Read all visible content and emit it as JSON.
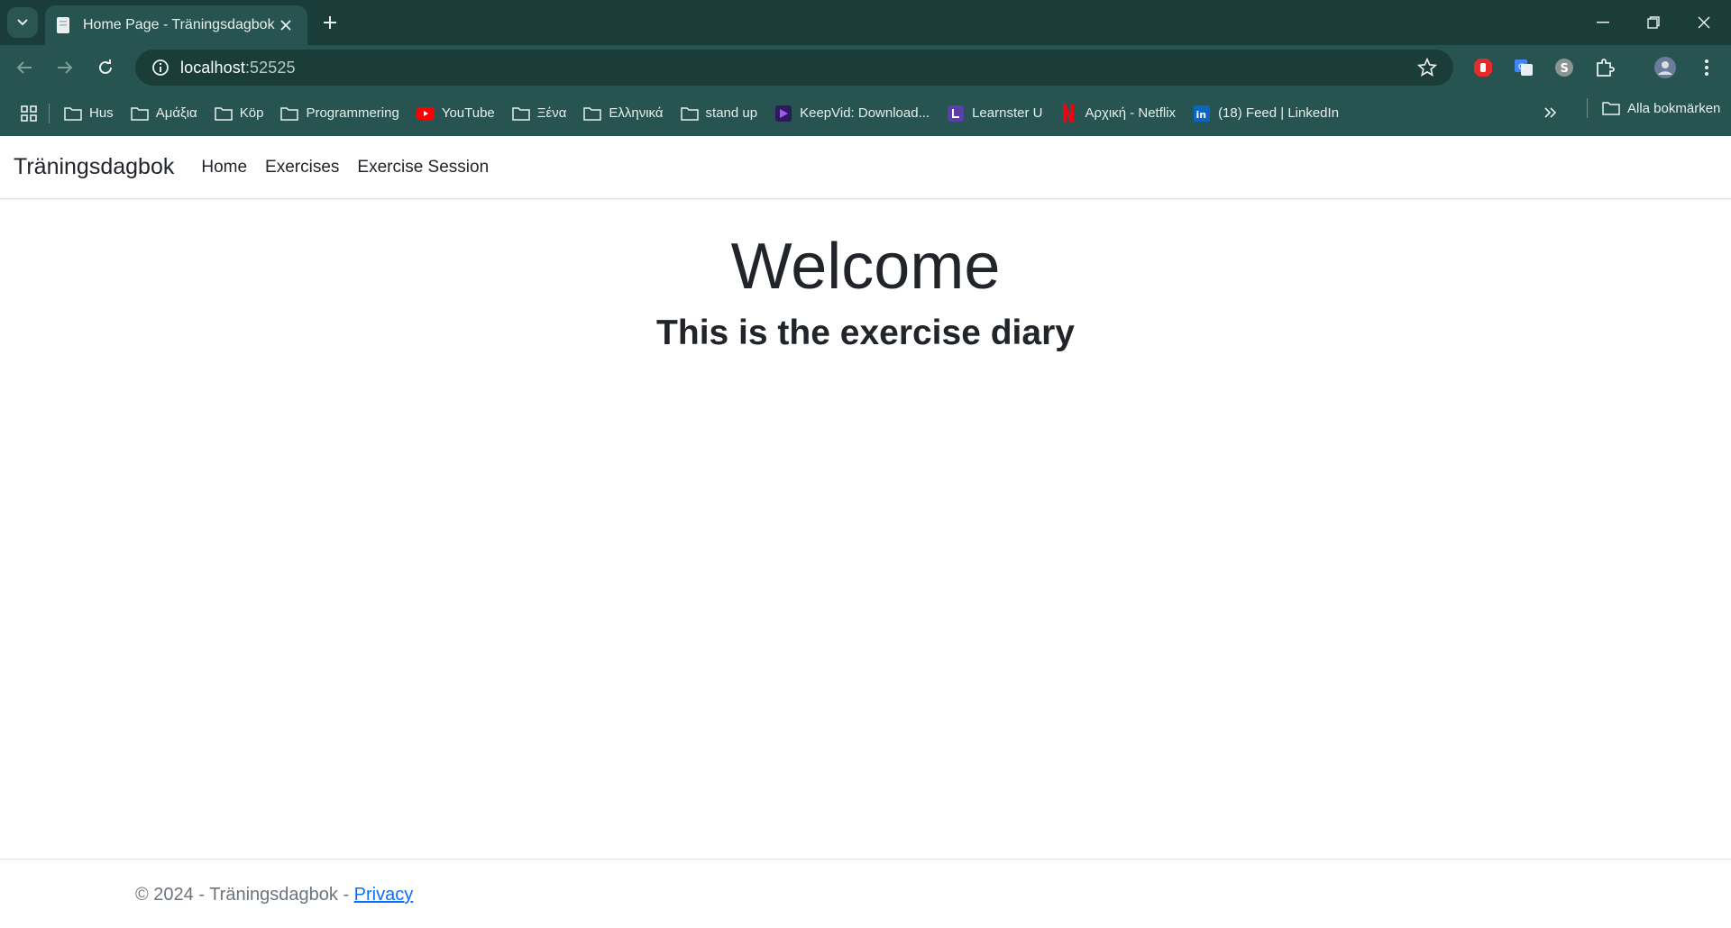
{
  "browser": {
    "tab_title": "Home Page - Träningsdagbok",
    "url_host": "localhost",
    "url_port": ":52525"
  },
  "bookmarks": [
    {
      "label": "Hus",
      "icon": "folder-icon"
    },
    {
      "label": "Αμάξια",
      "icon": "folder-icon"
    },
    {
      "label": "Köp",
      "icon": "folder-icon"
    },
    {
      "label": "Programmering",
      "icon": "folder-icon"
    },
    {
      "label": "YouTube",
      "icon": "youtube-icon"
    },
    {
      "label": "Ξένα",
      "icon": "folder-icon"
    },
    {
      "label": "Ελληνικά",
      "icon": "folder-icon"
    },
    {
      "label": "stand up",
      "icon": "folder-icon"
    },
    {
      "label": "KeepVid: Download...",
      "icon": "keepvid-icon"
    },
    {
      "label": "Learnster U",
      "icon": "learnster-icon"
    },
    {
      "label": "Αρχική - Netflix",
      "icon": "netflix-icon"
    },
    {
      "label": "(18) Feed | LinkedIn",
      "icon": "linkedin-icon"
    }
  ],
  "bookmarks_all": "Alla bokmärken",
  "app": {
    "brand": "Träningsdagbok",
    "nav": [
      "Home",
      "Exercises",
      "Exercise Session"
    ],
    "welcome": "Welcome",
    "subtitle": "This is the exercise diary",
    "footer_text": "© 2024 - Träningsdagbok - ",
    "footer_link": "Privacy"
  },
  "colors": {
    "chrome_dark": "#1b3d3a",
    "chrome": "#275450",
    "link": "#0d6efd"
  }
}
